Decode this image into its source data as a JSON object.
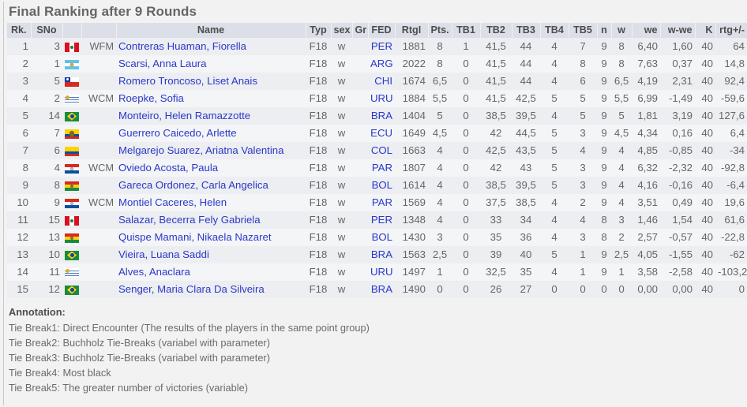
{
  "page": {
    "title": "Final Ranking after 9 Rounds"
  },
  "table": {
    "columns": [
      {
        "key": "rk",
        "label": "Rk."
      },
      {
        "key": "sno",
        "label": "SNo"
      },
      {
        "key": "flag",
        "label": ""
      },
      {
        "key": "ttl",
        "label": ""
      },
      {
        "key": "name",
        "label": "Name"
      },
      {
        "key": "typ",
        "label": "Typ"
      },
      {
        "key": "sex",
        "label": "sex"
      },
      {
        "key": "gr",
        "label": "Gr"
      },
      {
        "key": "fed",
        "label": "FED"
      },
      {
        "key": "rtgi",
        "label": "RtgI"
      },
      {
        "key": "pts",
        "label": "Pts."
      },
      {
        "key": "tb1",
        "label": "TB1"
      },
      {
        "key": "tb2",
        "label": "TB2"
      },
      {
        "key": "tb3",
        "label": "TB3"
      },
      {
        "key": "tb4",
        "label": "TB4"
      },
      {
        "key": "tb5",
        "label": "TB5"
      },
      {
        "key": "n",
        "label": "n"
      },
      {
        "key": "w",
        "label": "w"
      },
      {
        "key": "we",
        "label": "we"
      },
      {
        "key": "wwe",
        "label": "w-we"
      },
      {
        "key": "k",
        "label": "K"
      },
      {
        "key": "rtg",
        "label": "rtg+/-"
      }
    ],
    "rows": [
      {
        "rk": "1",
        "sno": "3",
        "flag": "PER",
        "ttl": "WFM",
        "name": "Contreras Huaman, Fiorella",
        "typ": "F18",
        "sex": "w",
        "gr": "",
        "fed": "PER",
        "rtgi": "1881",
        "pts": "8",
        "tb1": "1",
        "tb2": "41,5",
        "tb3": "44",
        "tb4": "4",
        "tb5": "7",
        "n": "9",
        "w": "8",
        "we": "6,40",
        "wwe": "1,60",
        "k": "40",
        "rtg": "64"
      },
      {
        "rk": "2",
        "sno": "1",
        "flag": "ARG",
        "ttl": "",
        "name": "Scarsi, Anna Laura",
        "typ": "F18",
        "sex": "w",
        "gr": "",
        "fed": "ARG",
        "rtgi": "2022",
        "pts": "8",
        "tb1": "0",
        "tb2": "41,5",
        "tb3": "44",
        "tb4": "4",
        "tb5": "8",
        "n": "9",
        "w": "8",
        "we": "7,63",
        "wwe": "0,37",
        "k": "40",
        "rtg": "14,8"
      },
      {
        "rk": "3",
        "sno": "5",
        "flag": "CHI",
        "ttl": "",
        "name": "Romero Troncoso, Liset Anais",
        "typ": "F18",
        "sex": "w",
        "gr": "",
        "fed": "CHI",
        "rtgi": "1674",
        "pts": "6,5",
        "tb1": "0",
        "tb2": "41,5",
        "tb3": "44",
        "tb4": "4",
        "tb5": "6",
        "n": "9",
        "w": "6,5",
        "we": "4,19",
        "wwe": "2,31",
        "k": "40",
        "rtg": "92,4"
      },
      {
        "rk": "4",
        "sno": "2",
        "flag": "URU",
        "ttl": "WCM",
        "name": "Roepke, Sofia",
        "typ": "F18",
        "sex": "w",
        "gr": "",
        "fed": "URU",
        "rtgi": "1884",
        "pts": "5,5",
        "tb1": "0",
        "tb2": "41,5",
        "tb3": "42,5",
        "tb4": "5",
        "tb5": "5",
        "n": "9",
        "w": "5,5",
        "we": "6,99",
        "wwe": "-1,49",
        "k": "40",
        "rtg": "-59,6"
      },
      {
        "rk": "5",
        "sno": "14",
        "flag": "BRA",
        "ttl": "",
        "name": "Monteiro, Helen Ramazzotte",
        "typ": "F18",
        "sex": "w",
        "gr": "",
        "fed": "BRA",
        "rtgi": "1404",
        "pts": "5",
        "tb1": "0",
        "tb2": "38,5",
        "tb3": "39,5",
        "tb4": "4",
        "tb5": "5",
        "n": "9",
        "w": "5",
        "we": "1,81",
        "wwe": "3,19",
        "k": "40",
        "rtg": "127,6"
      },
      {
        "rk": "6",
        "sno": "7",
        "flag": "ECU",
        "ttl": "",
        "name": "Guerrero Caicedo, Arlette",
        "typ": "F18",
        "sex": "w",
        "gr": "",
        "fed": "ECU",
        "rtgi": "1649",
        "pts": "4,5",
        "tb1": "0",
        "tb2": "42",
        "tb3": "44,5",
        "tb4": "5",
        "tb5": "3",
        "n": "9",
        "w": "4,5",
        "we": "4,34",
        "wwe": "0,16",
        "k": "40",
        "rtg": "6,4"
      },
      {
        "rk": "7",
        "sno": "6",
        "flag": "COL",
        "ttl": "",
        "name": "Melgarejo Suarez, Ariatna Valentina",
        "typ": "F18",
        "sex": "w",
        "gr": "",
        "fed": "COL",
        "rtgi": "1663",
        "pts": "4",
        "tb1": "0",
        "tb2": "42,5",
        "tb3": "43,5",
        "tb4": "5",
        "tb5": "4",
        "n": "9",
        "w": "4",
        "we": "4,85",
        "wwe": "-0,85",
        "k": "40",
        "rtg": "-34"
      },
      {
        "rk": "8",
        "sno": "4",
        "flag": "PAR",
        "ttl": "WCM",
        "name": "Oviedo Acosta, Paula",
        "typ": "F18",
        "sex": "w",
        "gr": "",
        "fed": "PAR",
        "rtgi": "1807",
        "pts": "4",
        "tb1": "0",
        "tb2": "42",
        "tb3": "43",
        "tb4": "5",
        "tb5": "3",
        "n": "9",
        "w": "4",
        "we": "6,32",
        "wwe": "-2,32",
        "k": "40",
        "rtg": "-92,8"
      },
      {
        "rk": "9",
        "sno": "8",
        "flag": "BOL",
        "ttl": "",
        "name": "Gareca Ordonez, Carla Angelica",
        "typ": "F18",
        "sex": "w",
        "gr": "",
        "fed": "BOL",
        "rtgi": "1614",
        "pts": "4",
        "tb1": "0",
        "tb2": "38,5",
        "tb3": "39,5",
        "tb4": "5",
        "tb5": "3",
        "n": "9",
        "w": "4",
        "we": "4,16",
        "wwe": "-0,16",
        "k": "40",
        "rtg": "-6,4"
      },
      {
        "rk": "10",
        "sno": "9",
        "flag": "PAR",
        "ttl": "WCM",
        "name": "Montiel Caceres, Helen",
        "typ": "F18",
        "sex": "w",
        "gr": "",
        "fed": "PAR",
        "rtgi": "1569",
        "pts": "4",
        "tb1": "0",
        "tb2": "37,5",
        "tb3": "38,5",
        "tb4": "4",
        "tb5": "2",
        "n": "9",
        "w": "4",
        "we": "3,51",
        "wwe": "0,49",
        "k": "40",
        "rtg": "19,6"
      },
      {
        "rk": "11",
        "sno": "15",
        "flag": "PER",
        "ttl": "",
        "name": "Salazar, Becerra Fely Gabriela",
        "typ": "F18",
        "sex": "w",
        "gr": "",
        "fed": "PER",
        "rtgi": "1348",
        "pts": "4",
        "tb1": "0",
        "tb2": "33",
        "tb3": "34",
        "tb4": "4",
        "tb5": "4",
        "n": "8",
        "w": "3",
        "we": "1,46",
        "wwe": "1,54",
        "k": "40",
        "rtg": "61,6"
      },
      {
        "rk": "12",
        "sno": "13",
        "flag": "BOL",
        "ttl": "",
        "name": "Quispe Mamani, Nikaela Nazaret",
        "typ": "F18",
        "sex": "w",
        "gr": "",
        "fed": "BOL",
        "rtgi": "1430",
        "pts": "3",
        "tb1": "0",
        "tb2": "35",
        "tb3": "36",
        "tb4": "4",
        "tb5": "3",
        "n": "8",
        "w": "2",
        "we": "2,57",
        "wwe": "-0,57",
        "k": "40",
        "rtg": "-22,8"
      },
      {
        "rk": "13",
        "sno": "10",
        "flag": "BRA",
        "ttl": "",
        "name": "Vieira, Luana Saddi",
        "typ": "F18",
        "sex": "w",
        "gr": "",
        "fed": "BRA",
        "rtgi": "1563",
        "pts": "2,5",
        "tb1": "0",
        "tb2": "39",
        "tb3": "40",
        "tb4": "5",
        "tb5": "1",
        "n": "9",
        "w": "2,5",
        "we": "4,05",
        "wwe": "-1,55",
        "k": "40",
        "rtg": "-62"
      },
      {
        "rk": "14",
        "sno": "11",
        "flag": "URU",
        "ttl": "",
        "name": "Alves, Anaclara",
        "typ": "F18",
        "sex": "w",
        "gr": "",
        "fed": "URU",
        "rtgi": "1497",
        "pts": "1",
        "tb1": "0",
        "tb2": "32,5",
        "tb3": "35",
        "tb4": "4",
        "tb5": "1",
        "n": "9",
        "w": "1",
        "we": "3,58",
        "wwe": "-2,58",
        "k": "40",
        "rtg": "-103,2"
      },
      {
        "rk": "15",
        "sno": "12",
        "flag": "BRA",
        "ttl": "",
        "name": "Senger, Maria Clara Da Silveira",
        "typ": "F18",
        "sex": "w",
        "gr": "",
        "fed": "BRA",
        "rtgi": "1490",
        "pts": "0",
        "tb1": "0",
        "tb2": "26",
        "tb3": "27",
        "tb4": "0",
        "tb5": "0",
        "n": "0",
        "w": "0",
        "we": "0,00",
        "wwe": "0,00",
        "k": "40",
        "rtg": "0"
      }
    ]
  },
  "annotation": {
    "heading": "Annotation:",
    "lines": [
      "Tie Break1: Direct Encounter (The results of the players in the same point group)",
      "Tie Break2: Buchholz Tie-Breaks (variabel with parameter)",
      "Tie Break3: Buchholz Tie-Breaks (variabel with parameter)",
      "Tie Break4: Most black",
      "Tie Break5: The greater number of victories (variable)"
    ]
  },
  "colors": {
    "link": "#2b38c8",
    "header_bg": "#dcdfe8",
    "row_odd": "#eceef1",
    "row_even": "#f4f5f7",
    "text": "#666666",
    "page_bg": "#f2f2f2"
  }
}
